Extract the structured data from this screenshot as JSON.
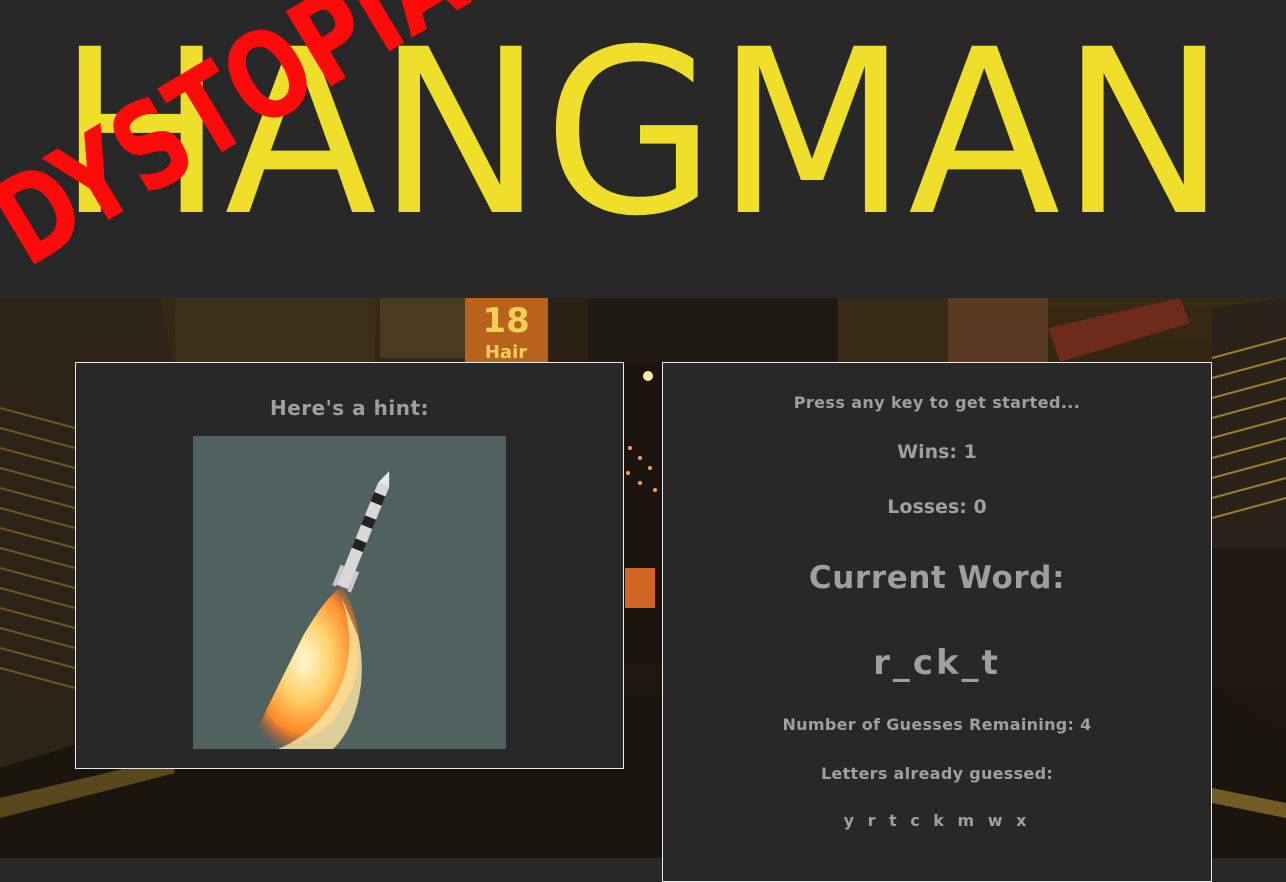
{
  "header": {
    "title": "HANGMAN",
    "overlay_word": "DYSTOPIA",
    "title_color": "#f0df2a",
    "overlay_color": "#ff0a0a"
  },
  "hint_panel": {
    "heading": "Here's a hint:",
    "image_icon": "rocket-launch-icon"
  },
  "game_panel": {
    "prompt": "Press any key to get started...",
    "wins_label": "Wins: 1",
    "losses_label": "Losses: 0",
    "current_word_label": "Current Word:",
    "current_word_value": "r_ck_t",
    "guesses_remaining_label": "Number of Guesses Remaining: 4",
    "letters_guessed_label": "Letters already guessed:",
    "letters_guessed_value": "y r t c k m w x"
  },
  "background": {
    "sign_text_number": "18",
    "sign_text_word": "Hair"
  }
}
